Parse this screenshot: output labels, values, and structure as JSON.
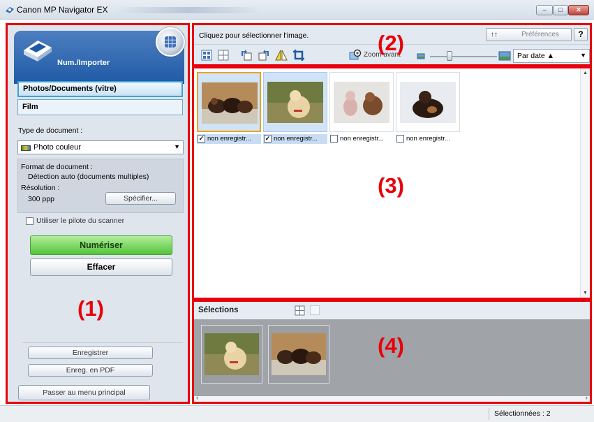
{
  "window": {
    "title": "Canon MP Navigator EX",
    "min_label": "–",
    "max_label": "□",
    "close_label": "✕"
  },
  "left_panel": {
    "nav_label": "Num./Importer",
    "tabs": [
      {
        "label": "Photos/Documents (vitre)",
        "active": true
      },
      {
        "label": "Film",
        "active": false
      }
    ],
    "doc_type_label": "Type de document :",
    "doc_type_value": "Photo couleur",
    "doc_format_label": "Format de document :",
    "doc_format_value": "Détection auto (documents multiples)",
    "resolution_label": "Résolution :",
    "resolution_value": "300 ppp",
    "specify_label": "Spécifier...",
    "use_driver_label": "Utiliser le pilote du scanner",
    "scan_label": "Numériser",
    "clear_label": "Effacer",
    "save_label": "Enregistrer",
    "save_pdf_label": "Enreg. en PDF",
    "main_menu_label": "Passer au menu principal"
  },
  "toolbar": {
    "hint": "Cliquez pour sélectionner l'image.",
    "preferences_label": "Préférences",
    "help_label": "?",
    "zoom_label": "Zoom avant",
    "sort_value": "Par date ▲"
  },
  "thumbnails": [
    {
      "caption": "non enregistr...",
      "checked": true,
      "selected": true,
      "focused": true
    },
    {
      "caption": "non enregistr...",
      "checked": true,
      "selected": true,
      "focused": false
    },
    {
      "caption": "non enregistr...",
      "checked": false,
      "selected": false,
      "focused": false
    },
    {
      "caption": "non enregistr...",
      "checked": false,
      "selected": false,
      "focused": false
    }
  ],
  "selections": {
    "label": "Sélections"
  },
  "status": {
    "selected_text": "Sélectionnées : 2"
  },
  "annotations": {
    "n1": "(1)",
    "n2": "(2)",
    "n3": "(3)",
    "n4": "(4)"
  },
  "colors": {
    "annotation_red": "#e8000b",
    "scan_green": "#53c43a",
    "nav_blue": "#1f5aa5",
    "focus_orange": "#f0a21e"
  }
}
